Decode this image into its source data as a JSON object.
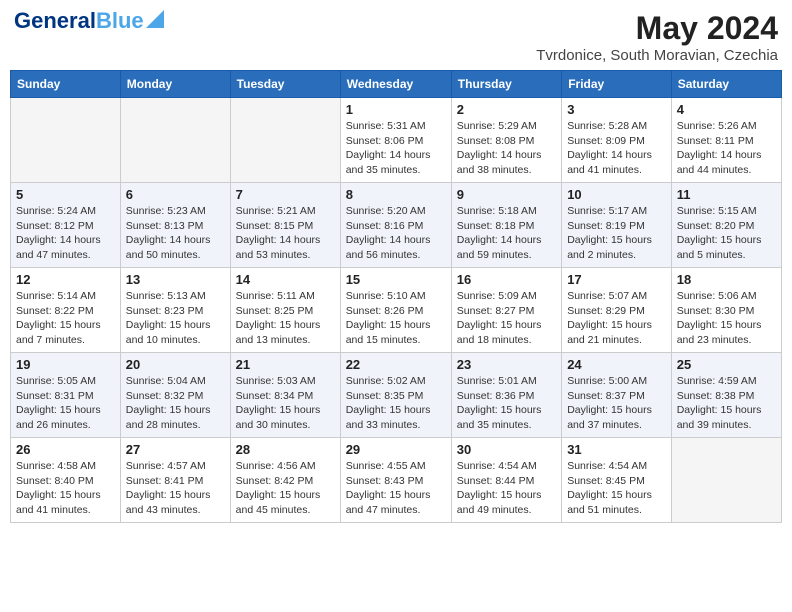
{
  "header": {
    "logo_line1": "General",
    "logo_line2": "Blue",
    "month_year": "May 2024",
    "location": "Tvrdonice, South Moravian, Czechia"
  },
  "days_of_week": [
    "Sunday",
    "Monday",
    "Tuesday",
    "Wednesday",
    "Thursday",
    "Friday",
    "Saturday"
  ],
  "weeks": [
    [
      {
        "day": null
      },
      {
        "day": null
      },
      {
        "day": null
      },
      {
        "day": "1",
        "sunrise": "5:31 AM",
        "sunset": "8:06 PM",
        "daylight": "14 hours and 35 minutes."
      },
      {
        "day": "2",
        "sunrise": "5:29 AM",
        "sunset": "8:08 PM",
        "daylight": "14 hours and 38 minutes."
      },
      {
        "day": "3",
        "sunrise": "5:28 AM",
        "sunset": "8:09 PM",
        "daylight": "14 hours and 41 minutes."
      },
      {
        "day": "4",
        "sunrise": "5:26 AM",
        "sunset": "8:11 PM",
        "daylight": "14 hours and 44 minutes."
      }
    ],
    [
      {
        "day": "5",
        "sunrise": "5:24 AM",
        "sunset": "8:12 PM",
        "daylight": "14 hours and 47 minutes."
      },
      {
        "day": "6",
        "sunrise": "5:23 AM",
        "sunset": "8:13 PM",
        "daylight": "14 hours and 50 minutes."
      },
      {
        "day": "7",
        "sunrise": "5:21 AM",
        "sunset": "8:15 PM",
        "daylight": "14 hours and 53 minutes."
      },
      {
        "day": "8",
        "sunrise": "5:20 AM",
        "sunset": "8:16 PM",
        "daylight": "14 hours and 56 minutes."
      },
      {
        "day": "9",
        "sunrise": "5:18 AM",
        "sunset": "8:18 PM",
        "daylight": "14 hours and 59 minutes."
      },
      {
        "day": "10",
        "sunrise": "5:17 AM",
        "sunset": "8:19 PM",
        "daylight": "15 hours and 2 minutes."
      },
      {
        "day": "11",
        "sunrise": "5:15 AM",
        "sunset": "8:20 PM",
        "daylight": "15 hours and 5 minutes."
      }
    ],
    [
      {
        "day": "12",
        "sunrise": "5:14 AM",
        "sunset": "8:22 PM",
        "daylight": "15 hours and 7 minutes."
      },
      {
        "day": "13",
        "sunrise": "5:13 AM",
        "sunset": "8:23 PM",
        "daylight": "15 hours and 10 minutes."
      },
      {
        "day": "14",
        "sunrise": "5:11 AM",
        "sunset": "8:25 PM",
        "daylight": "15 hours and 13 minutes."
      },
      {
        "day": "15",
        "sunrise": "5:10 AM",
        "sunset": "8:26 PM",
        "daylight": "15 hours and 15 minutes."
      },
      {
        "day": "16",
        "sunrise": "5:09 AM",
        "sunset": "8:27 PM",
        "daylight": "15 hours and 18 minutes."
      },
      {
        "day": "17",
        "sunrise": "5:07 AM",
        "sunset": "8:29 PM",
        "daylight": "15 hours and 21 minutes."
      },
      {
        "day": "18",
        "sunrise": "5:06 AM",
        "sunset": "8:30 PM",
        "daylight": "15 hours and 23 minutes."
      }
    ],
    [
      {
        "day": "19",
        "sunrise": "5:05 AM",
        "sunset": "8:31 PM",
        "daylight": "15 hours and 26 minutes."
      },
      {
        "day": "20",
        "sunrise": "5:04 AM",
        "sunset": "8:32 PM",
        "daylight": "15 hours and 28 minutes."
      },
      {
        "day": "21",
        "sunrise": "5:03 AM",
        "sunset": "8:34 PM",
        "daylight": "15 hours and 30 minutes."
      },
      {
        "day": "22",
        "sunrise": "5:02 AM",
        "sunset": "8:35 PM",
        "daylight": "15 hours and 33 minutes."
      },
      {
        "day": "23",
        "sunrise": "5:01 AM",
        "sunset": "8:36 PM",
        "daylight": "15 hours and 35 minutes."
      },
      {
        "day": "24",
        "sunrise": "5:00 AM",
        "sunset": "8:37 PM",
        "daylight": "15 hours and 37 minutes."
      },
      {
        "day": "25",
        "sunrise": "4:59 AM",
        "sunset": "8:38 PM",
        "daylight": "15 hours and 39 minutes."
      }
    ],
    [
      {
        "day": "26",
        "sunrise": "4:58 AM",
        "sunset": "8:40 PM",
        "daylight": "15 hours and 41 minutes."
      },
      {
        "day": "27",
        "sunrise": "4:57 AM",
        "sunset": "8:41 PM",
        "daylight": "15 hours and 43 minutes."
      },
      {
        "day": "28",
        "sunrise": "4:56 AM",
        "sunset": "8:42 PM",
        "daylight": "15 hours and 45 minutes."
      },
      {
        "day": "29",
        "sunrise": "4:55 AM",
        "sunset": "8:43 PM",
        "daylight": "15 hours and 47 minutes."
      },
      {
        "day": "30",
        "sunrise": "4:54 AM",
        "sunset": "8:44 PM",
        "daylight": "15 hours and 49 minutes."
      },
      {
        "day": "31",
        "sunrise": "4:54 AM",
        "sunset": "8:45 PM",
        "daylight": "15 hours and 51 minutes."
      },
      {
        "day": null
      }
    ]
  ],
  "labels": {
    "sunrise": "Sunrise:",
    "sunset": "Sunset:",
    "daylight": "Daylight:"
  }
}
